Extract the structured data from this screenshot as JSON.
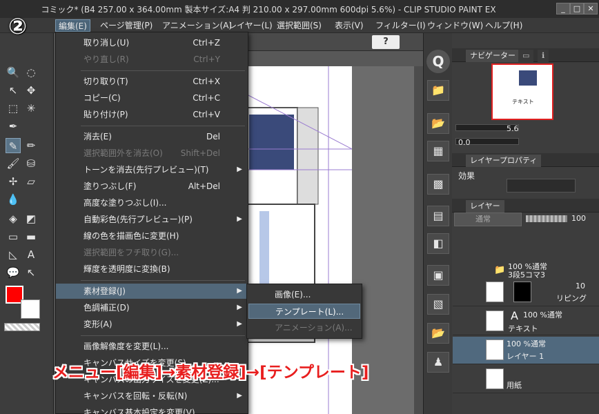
{
  "window": {
    "title": "コミック* (B4 257.00 x 364.00mm 製本サイズ:A4 判 210.00 x 297.00mm 600dpi 5.6%) - CLIP STUDIO PAINT EX",
    "minimize": "_",
    "maximize": "□",
    "close": "✕"
  },
  "step_marker": "②",
  "menubar": {
    "items": [
      {
        "label": "編集(E)"
      },
      {
        "label": "ページ管理(P)"
      },
      {
        "label": "アニメーション(A)"
      },
      {
        "label": "レイヤー(L)"
      },
      {
        "label": "選択範囲(S)"
      },
      {
        "label": "表示(V)"
      },
      {
        "label": "フィルター(I)"
      },
      {
        "label": "ウィンドウ(W)"
      },
      {
        "label": "ヘルプ(H)"
      }
    ]
  },
  "edit_menu": {
    "items": [
      {
        "label": "取り消し(U)",
        "shortcut": "Ctrl+Z",
        "enabled": true
      },
      {
        "label": "やり直し(R)",
        "shortcut": "Ctrl+Y",
        "enabled": false
      },
      {
        "label": "切り取り(T)",
        "shortcut": "Ctrl+X",
        "enabled": true
      },
      {
        "label": "コピー(C)",
        "shortcut": "Ctrl+C",
        "enabled": true
      },
      {
        "label": "貼り付け(P)",
        "shortcut": "Ctrl+V",
        "enabled": true
      },
      {
        "label": "消去(E)",
        "shortcut": "Del",
        "enabled": true
      },
      {
        "label": "選択範囲外を消去(O)",
        "shortcut": "Shift+Del",
        "enabled": false
      },
      {
        "label": "トーンを消去(先行プレビュー)(T)",
        "shortcut": "",
        "enabled": true,
        "submenu": true
      },
      {
        "label": "塗りつぶし(F)",
        "shortcut": "Alt+Del",
        "enabled": true
      },
      {
        "label": "高度な塗りつぶし(I)...",
        "shortcut": "",
        "enabled": true
      },
      {
        "label": "自動彩色(先行プレビュー)(P)",
        "shortcut": "",
        "enabled": true,
        "submenu": true
      },
      {
        "label": "線の色を描画色に変更(H)",
        "shortcut": "",
        "enabled": true
      },
      {
        "label": "選択範囲をフチ取り(G)...",
        "shortcut": "",
        "enabled": false
      },
      {
        "label": "輝度を透明度に変換(B)",
        "shortcut": "",
        "enabled": true
      },
      {
        "label": "素材登録(J)",
        "shortcut": "",
        "enabled": true,
        "submenu": true,
        "highlighted": true
      },
      {
        "label": "色調補正(D)",
        "shortcut": "",
        "enabled": true,
        "submenu": true
      },
      {
        "label": "変形(A)",
        "shortcut": "",
        "enabled": true,
        "submenu": true
      },
      {
        "label": "画像解像度を変更(L)...",
        "shortcut": "",
        "enabled": true
      },
      {
        "label": "キャンバスサイズを変更(S)...",
        "shortcut": "",
        "enabled": true
      },
      {
        "label": "キャンバスの出力サイズを変更(Z)...",
        "shortcut": "",
        "enabled": true
      },
      {
        "label": "キャンバスを回転・反転(N)",
        "shortcut": "",
        "enabled": true,
        "submenu": true
      },
      {
        "label": "キャンバス基本設定を変更(V)...",
        "shortcut": "",
        "enabled": true
      }
    ]
  },
  "material_submenu": {
    "items": [
      {
        "label": "画像(E)...",
        "enabled": true
      },
      {
        "label": "テンプレート(L)...",
        "enabled": true,
        "highlighted": true
      },
      {
        "label": "アニメーション(A)...",
        "enabled": false
      }
    ]
  },
  "annotation": "メニュー[編集]→素材登録]→[テンプレート]",
  "navigator": {
    "tab_label": "ナビゲーター",
    "zoom": "5.6",
    "angle": "0.0",
    "preview_text": "テキスト"
  },
  "layer_property": {
    "tab_label": "レイヤープロパティ",
    "effect_label": "効果"
  },
  "layers": {
    "tab_label": "レイヤー",
    "blend_mode": "通常",
    "opacity": "100",
    "rows": [
      {
        "opacity_mode": "100 %通常",
        "name": "3段5コマ3",
        "type": "folder"
      },
      {
        "opacity_mode": "",
        "name": "リピング",
        "type": "frame",
        "opacity_partial": "10"
      },
      {
        "opacity_mode": "100 %通常",
        "name": "テキスト",
        "type": "text"
      },
      {
        "opacity_mode": "100 %通常",
        "name": "レイヤー 1",
        "type": "raster",
        "selected": true
      },
      {
        "opacity_mode": "",
        "name": "用紙",
        "type": "paper"
      }
    ]
  },
  "colors": {
    "accent_red": "#e81e1e",
    "menu_highlight": "#52687a",
    "main_color": "#ff0000",
    "sub_color": "#ffffff"
  }
}
